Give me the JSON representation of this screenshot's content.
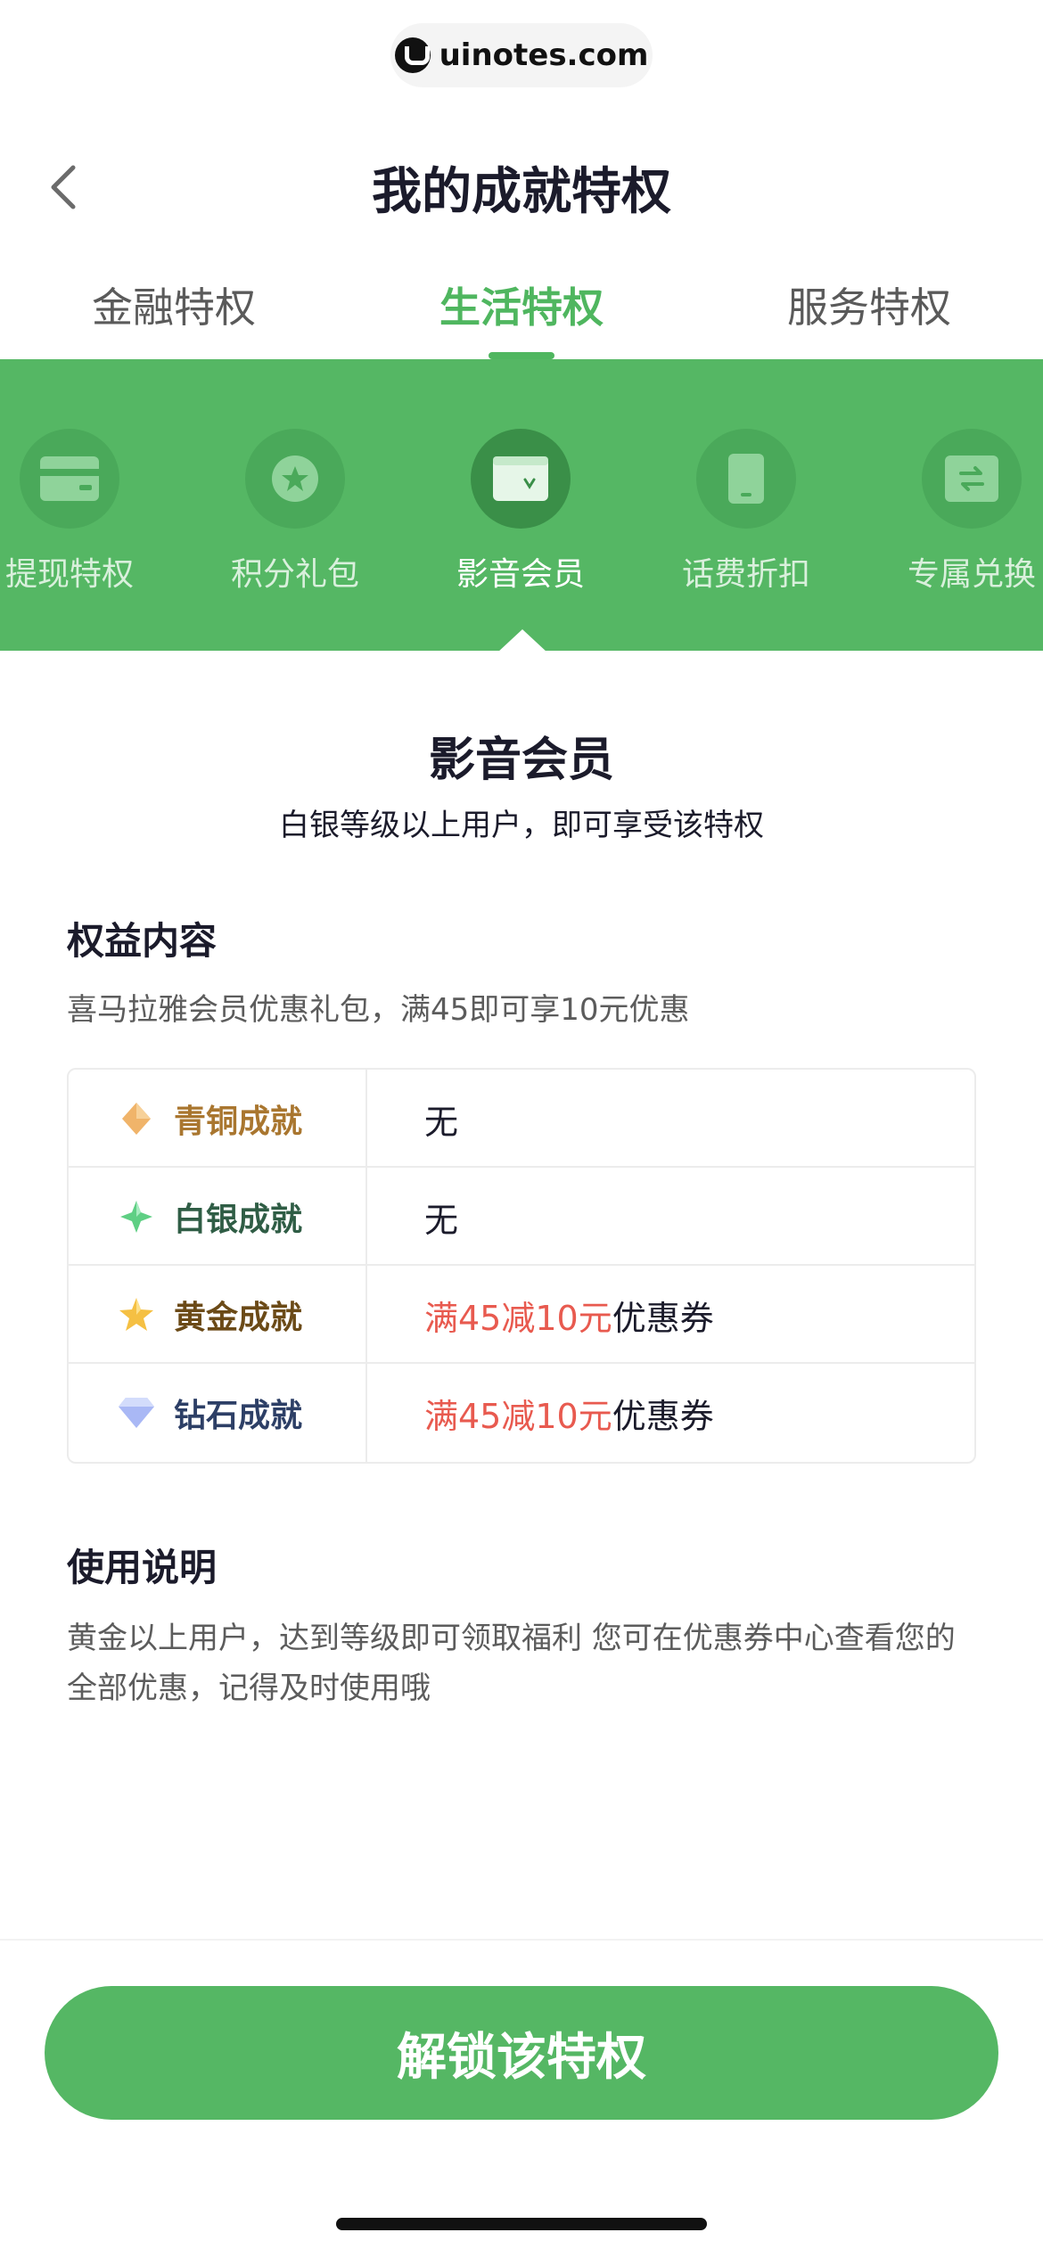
{
  "watermark": {
    "text": "uinotes.com"
  },
  "header": {
    "title": "我的成就特权"
  },
  "tabs": [
    {
      "label": "金融特权",
      "active": false
    },
    {
      "label": "生活特权",
      "active": true
    },
    {
      "label": "服务特权",
      "active": false
    }
  ],
  "privileges": [
    {
      "label": "提现特权",
      "icon": "card-icon",
      "active": false
    },
    {
      "label": "积分礼包",
      "icon": "star-badge-icon",
      "active": false
    },
    {
      "label": "影音会员",
      "icon": "video-member-icon",
      "active": true
    },
    {
      "label": "话费折扣",
      "icon": "phone-icon",
      "active": false
    },
    {
      "label": "专属兑换",
      "icon": "exchange-icon",
      "active": false
    }
  ],
  "detail": {
    "title": "影音会员",
    "subtitle": "白银等级以上用户，即可享受该特权"
  },
  "benefits": {
    "heading": "权益内容",
    "desc": "喜马拉雅会员优惠礼包，满45即可享10元优惠",
    "rows": [
      {
        "level": "青铜成就",
        "icon": "bronze-diamond-icon",
        "color": "#a9762f",
        "highlight": "",
        "value": "无"
      },
      {
        "level": "白银成就",
        "icon": "silver-star-icon",
        "color": "#2f5d45",
        "highlight": "",
        "value": "无"
      },
      {
        "level": "黄金成就",
        "icon": "gold-star-icon",
        "color": "#6b4a17",
        "highlight": "满45减10元",
        "value": "优惠券"
      },
      {
        "level": "钻石成就",
        "icon": "diamond-icon",
        "color": "#2d3f66",
        "highlight": "满45减10元",
        "value": "优惠券"
      }
    ]
  },
  "usage": {
    "heading": "使用说明",
    "desc": "黄金以上用户，达到等级即可领取福利 您可在优惠券中心查看您的全部优惠，记得及时使用哦"
  },
  "cta": {
    "label": "解锁该特权"
  },
  "colors": {
    "accent": "#55b764",
    "accent_text": "#4fb65f",
    "coupon_red": "#e85a4f"
  }
}
